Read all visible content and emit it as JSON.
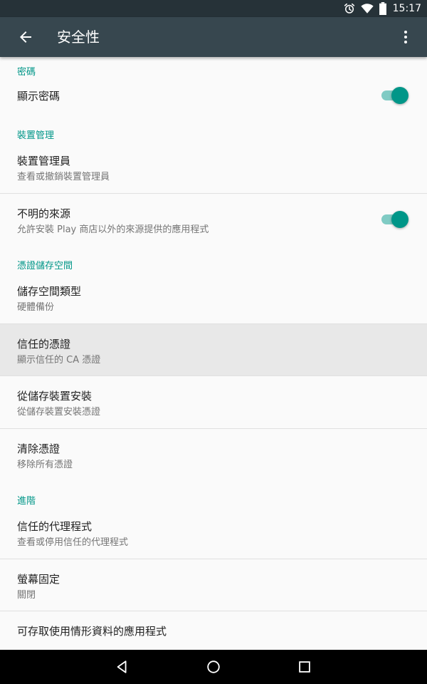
{
  "status_bar": {
    "time": "15:17",
    "icons": [
      "alarm-icon",
      "wifi-icon",
      "battery-icon"
    ]
  },
  "app_bar": {
    "title": "安全性",
    "back_icon": "arrow-back-icon",
    "menu_icon": "more-vert-icon"
  },
  "sections": {
    "password": {
      "header": "密碼",
      "show_password": {
        "title": "顯示密碼",
        "toggle_on": true
      }
    },
    "device_admin": {
      "header": "裝置管理",
      "device_admins": {
        "title": "裝置管理員",
        "summary": "查看或撤銷裝置管理員"
      },
      "unknown_sources": {
        "title": "不明的來源",
        "summary": "允許安裝 Play 商店以外的來源提供的應用程式",
        "toggle_on": true
      }
    },
    "credential_storage": {
      "header": "憑證儲存空間",
      "storage_type": {
        "title": "儲存空間類型",
        "summary": "硬體備份"
      },
      "trusted_credentials": {
        "title": "信任的憑證",
        "summary": "顯示信任的 CA 憑證"
      },
      "install_from_storage": {
        "title": "從儲存裝置安裝",
        "summary": "從儲存裝置安裝憑證"
      },
      "clear_credentials": {
        "title": "清除憑證",
        "summary": "移除所有憑證"
      }
    },
    "advanced": {
      "header": "進階",
      "trust_agents": {
        "title": "信任的代理程式",
        "summary": "查看或停用信任的代理程式"
      },
      "screen_pinning": {
        "title": "螢幕固定",
        "summary": "關閉"
      },
      "usage_access": {
        "title": "可存取使用情形資料的應用程式"
      }
    }
  },
  "nav_bar": {
    "icons": [
      "back-triangle-icon",
      "home-circle-icon",
      "recents-square-icon"
    ]
  },
  "colors": {
    "status_bar": "#263238",
    "app_bar": "#37474f",
    "accent": "#009688",
    "switch_track": "#80cbc4",
    "pressed_row": "#e8e8e8"
  }
}
